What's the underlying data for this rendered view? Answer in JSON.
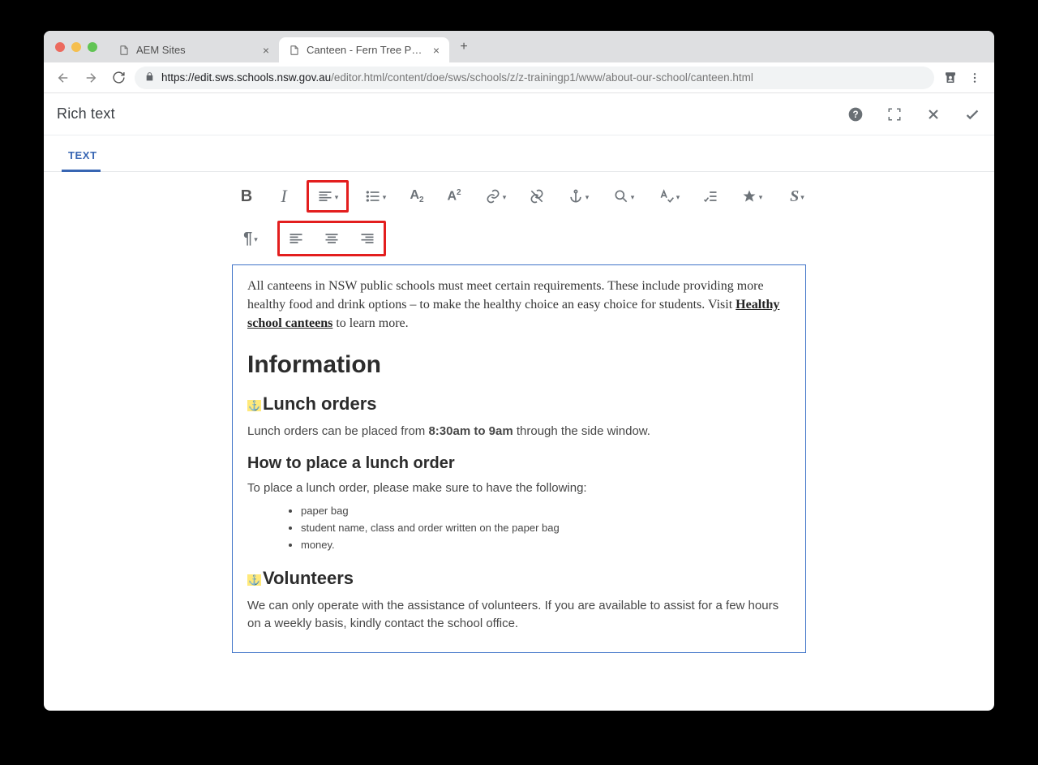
{
  "browser": {
    "tabs": [
      {
        "label": "AEM Sites",
        "active": false
      },
      {
        "label": "Canteen - Fern Tree Public Sch",
        "active": true
      }
    ],
    "url_host": "https://edit.sws.schools.nsw.gov.au",
    "url_path": "/editor.html/content/doe/sws/schools/z/z-trainingp1/www/about-our-school/canteen.html"
  },
  "dialog": {
    "title": "Rich text",
    "tab": "TEXT"
  },
  "toolbar": {
    "bold": "B",
    "italic": "I"
  },
  "content": {
    "intro_1": "All canteens in NSW public schools must meet certain requirements. These include providing more healthy food and drink options – to make the healthy choice an easy choice for students. Visit ",
    "intro_link": "Healthy school canteens",
    "intro_2": " to learn more.",
    "h2_information": "Information",
    "h3_lunch": "Lunch orders",
    "lunch_line_a": "Lunch orders can be placed from ",
    "lunch_bold": "8:30am to 9am",
    "lunch_line_b": " through the side window.",
    "h4_howto": "How to place a lunch order",
    "howto_intro": "To place a lunch order, please make sure to have the following:",
    "items": [
      "paper bag",
      "student name, class and order written on the paper bag",
      "money."
    ],
    "h3_vol": "Volunteers",
    "vol_body": "We can only operate with the assistance of volunteers. If you are available to assist for a few hours on a weekly basis, kindly contact the school office."
  }
}
